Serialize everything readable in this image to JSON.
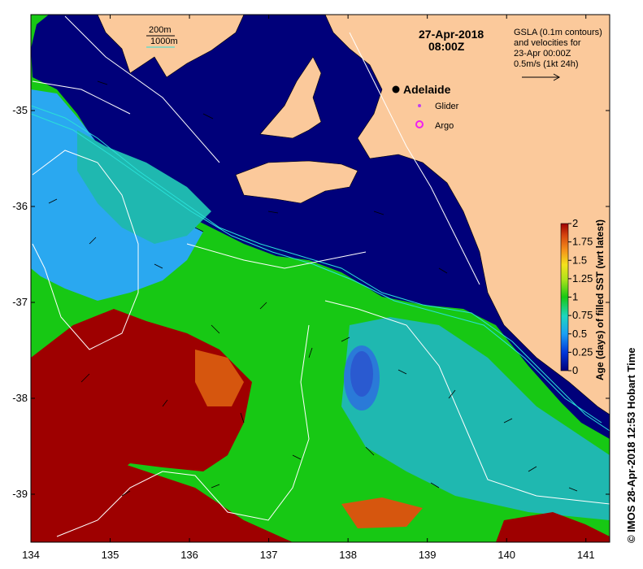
{
  "map": {
    "date": "27-Apr-2018",
    "time": "08:00Z",
    "city": "Adelaide",
    "legend": {
      "contour_200": "200m",
      "contour_1000": "1000m",
      "glider": "Glider",
      "argo": "Argo"
    },
    "gsla": {
      "line1": "GSLA (0.1m contours)",
      "line2": "and velocities for",
      "line3": "23-Apr 00:00Z",
      "line4": "0.5m/s (1kt 24h)"
    },
    "credit": "© IMOS 28-Apr-2018 12:53 Hobart Time",
    "colors": {
      "land": "#fbc99b",
      "ocean_fresh": "#00007a",
      "old": "#9e0000",
      "mid": "#17c814",
      "cyan": "#2aa8f0",
      "contour_200": "#2ae0d8"
    }
  },
  "axes": {
    "x": {
      "min": 134,
      "max": 141.3,
      "ticks": [
        "134",
        "135",
        "136",
        "137",
        "138",
        "139",
        "140",
        "141"
      ],
      "tick_values": [
        134,
        135,
        136,
        137,
        138,
        139,
        140,
        141
      ]
    },
    "y": {
      "min": -39.5,
      "max": -34.0,
      "ticks": [
        "-35",
        "-36",
        "-37",
        "-38",
        "-39"
      ],
      "tick_values": [
        -35,
        -36,
        -37,
        -38,
        -39
      ]
    }
  },
  "colorbar": {
    "label": "Age (days) of filled SST (wrt latest)",
    "ticks": [
      "2",
      "1.75",
      "1.5",
      "1.25",
      "1",
      "0.75",
      "0.5",
      "0.25",
      "0"
    ],
    "tick_values": [
      2,
      1.75,
      1.5,
      1.25,
      1,
      0.75,
      0.5,
      0.25,
      0
    ]
  }
}
